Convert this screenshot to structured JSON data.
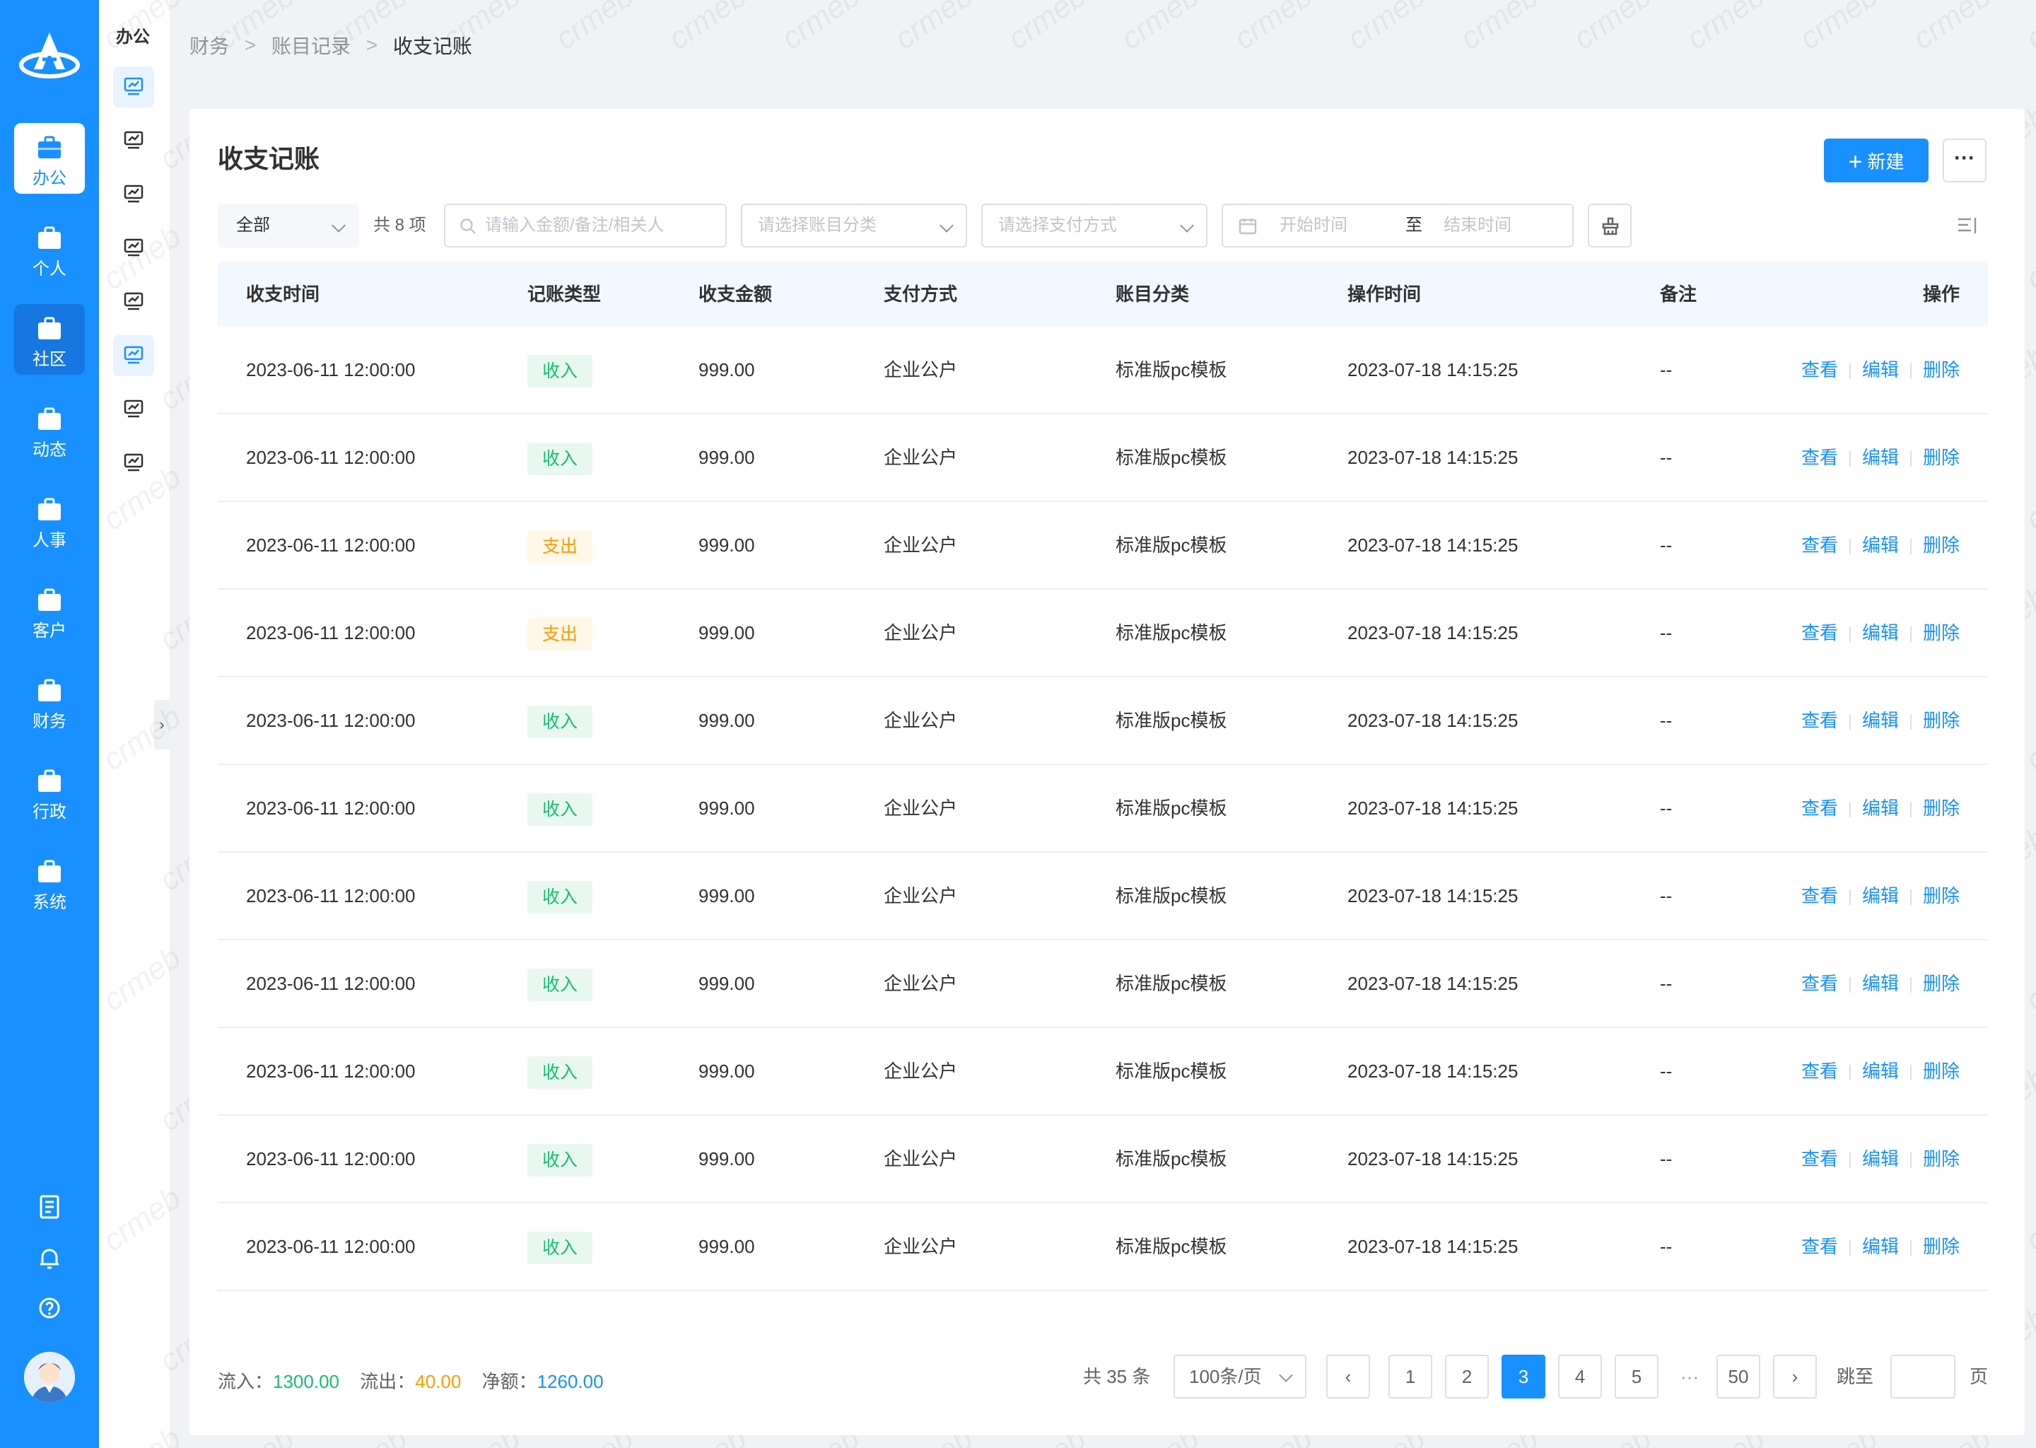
{
  "nav": {
    "items": [
      {
        "label": "办公",
        "icon": "briefcase-icon"
      },
      {
        "label": "个人",
        "icon": "briefcase-icon"
      },
      {
        "label": "社区",
        "icon": "briefcase-icon"
      },
      {
        "label": "动态",
        "icon": "briefcase-icon"
      },
      {
        "label": "人事",
        "icon": "briefcase-icon"
      },
      {
        "label": "客户",
        "icon": "briefcase-icon"
      },
      {
        "label": "财务",
        "icon": "briefcase-icon"
      },
      {
        "label": "行政",
        "icon": "briefcase-icon"
      },
      {
        "label": "系统",
        "icon": "briefcase-icon"
      }
    ],
    "bottom_icons": [
      "notebook-icon",
      "bell-icon",
      "help-icon"
    ]
  },
  "sub_sidebar": {
    "title": "办公",
    "item_icon": "chart-monitor-icon"
  },
  "breadcrumb": {
    "items": [
      "财务",
      "账目记录",
      "收支记账"
    ]
  },
  "page": {
    "title": "收支记账",
    "new_button": "新建",
    "more_button": "···"
  },
  "filters": {
    "type_select": "全部",
    "count_text": "共 8 项",
    "search_placeholder": "请输入金额/备注/相关人",
    "category_placeholder": "请选择账目分类",
    "pay_placeholder": "请选择支付方式",
    "start_placeholder": "开始时间",
    "range_to": "至",
    "end_placeholder": "结束时间"
  },
  "table": {
    "headers": [
      "收支时间",
      "记账类型",
      "收支金额",
      "支付方式",
      "账目分类",
      "操作时间",
      "备注",
      "操作"
    ],
    "actions": [
      "查看",
      "编辑",
      "删除"
    ],
    "rows": [
      {
        "time": "2023-06-11 12:00:00",
        "type": "收入",
        "kind": "in",
        "amount": "999.00",
        "pay": "企业公户",
        "cat": "标准版pc模板",
        "op_time": "2023-07-18 14:15:25",
        "note": "--"
      },
      {
        "time": "2023-06-11 12:00:00",
        "type": "收入",
        "kind": "in",
        "amount": "999.00",
        "pay": "企业公户",
        "cat": "标准版pc模板",
        "op_time": "2023-07-18 14:15:25",
        "note": "--"
      },
      {
        "time": "2023-06-11 12:00:00",
        "type": "支出",
        "kind": "out",
        "amount": "999.00",
        "pay": "企业公户",
        "cat": "标准版pc模板",
        "op_time": "2023-07-18 14:15:25",
        "note": "--"
      },
      {
        "time": "2023-06-11 12:00:00",
        "type": "支出",
        "kind": "out",
        "amount": "999.00",
        "pay": "企业公户",
        "cat": "标准版pc模板",
        "op_time": "2023-07-18 14:15:25",
        "note": "--"
      },
      {
        "time": "2023-06-11 12:00:00",
        "type": "收入",
        "kind": "in",
        "amount": "999.00",
        "pay": "企业公户",
        "cat": "标准版pc模板",
        "op_time": "2023-07-18 14:15:25",
        "note": "--"
      },
      {
        "time": "2023-06-11 12:00:00",
        "type": "收入",
        "kind": "in",
        "amount": "999.00",
        "pay": "企业公户",
        "cat": "标准版pc模板",
        "op_time": "2023-07-18 14:15:25",
        "note": "--"
      },
      {
        "time": "2023-06-11 12:00:00",
        "type": "收入",
        "kind": "in",
        "amount": "999.00",
        "pay": "企业公户",
        "cat": "标准版pc模板",
        "op_time": "2023-07-18 14:15:25",
        "note": "--"
      },
      {
        "time": "2023-06-11 12:00:00",
        "type": "收入",
        "kind": "in",
        "amount": "999.00",
        "pay": "企业公户",
        "cat": "标准版pc模板",
        "op_time": "2023-07-18 14:15:25",
        "note": "--"
      },
      {
        "time": "2023-06-11 12:00:00",
        "type": "收入",
        "kind": "in",
        "amount": "999.00",
        "pay": "企业公户",
        "cat": "标准版pc模板",
        "op_time": "2023-07-18 14:15:25",
        "note": "--"
      },
      {
        "time": "2023-06-11 12:00:00",
        "type": "收入",
        "kind": "in",
        "amount": "999.00",
        "pay": "企业公户",
        "cat": "标准版pc模板",
        "op_time": "2023-07-18 14:15:25",
        "note": "--"
      },
      {
        "time": "2023-06-11 12:00:00",
        "type": "收入",
        "kind": "in",
        "amount": "999.00",
        "pay": "企业公户",
        "cat": "标准版pc模板",
        "op_time": "2023-07-18 14:15:25",
        "note": "--"
      }
    ]
  },
  "summary": {
    "in_label": "流入：",
    "in_value": "1300.00",
    "out_label": "流出：",
    "out_value": "40.00",
    "net_label": "净额：",
    "net_value": "1260.00"
  },
  "pagination": {
    "total": "共 35 条",
    "page_size": "100条/页",
    "pages": [
      "1",
      "2",
      "3",
      "4",
      "5"
    ],
    "current": "3",
    "ellipsis": "···",
    "last": "50",
    "jump_label": "跳至",
    "page_suffix": "页"
  },
  "watermark": "crmeb",
  "colors": {
    "primary": "#1890ff",
    "income": "#19be6b",
    "expense": "#ff9900"
  }
}
